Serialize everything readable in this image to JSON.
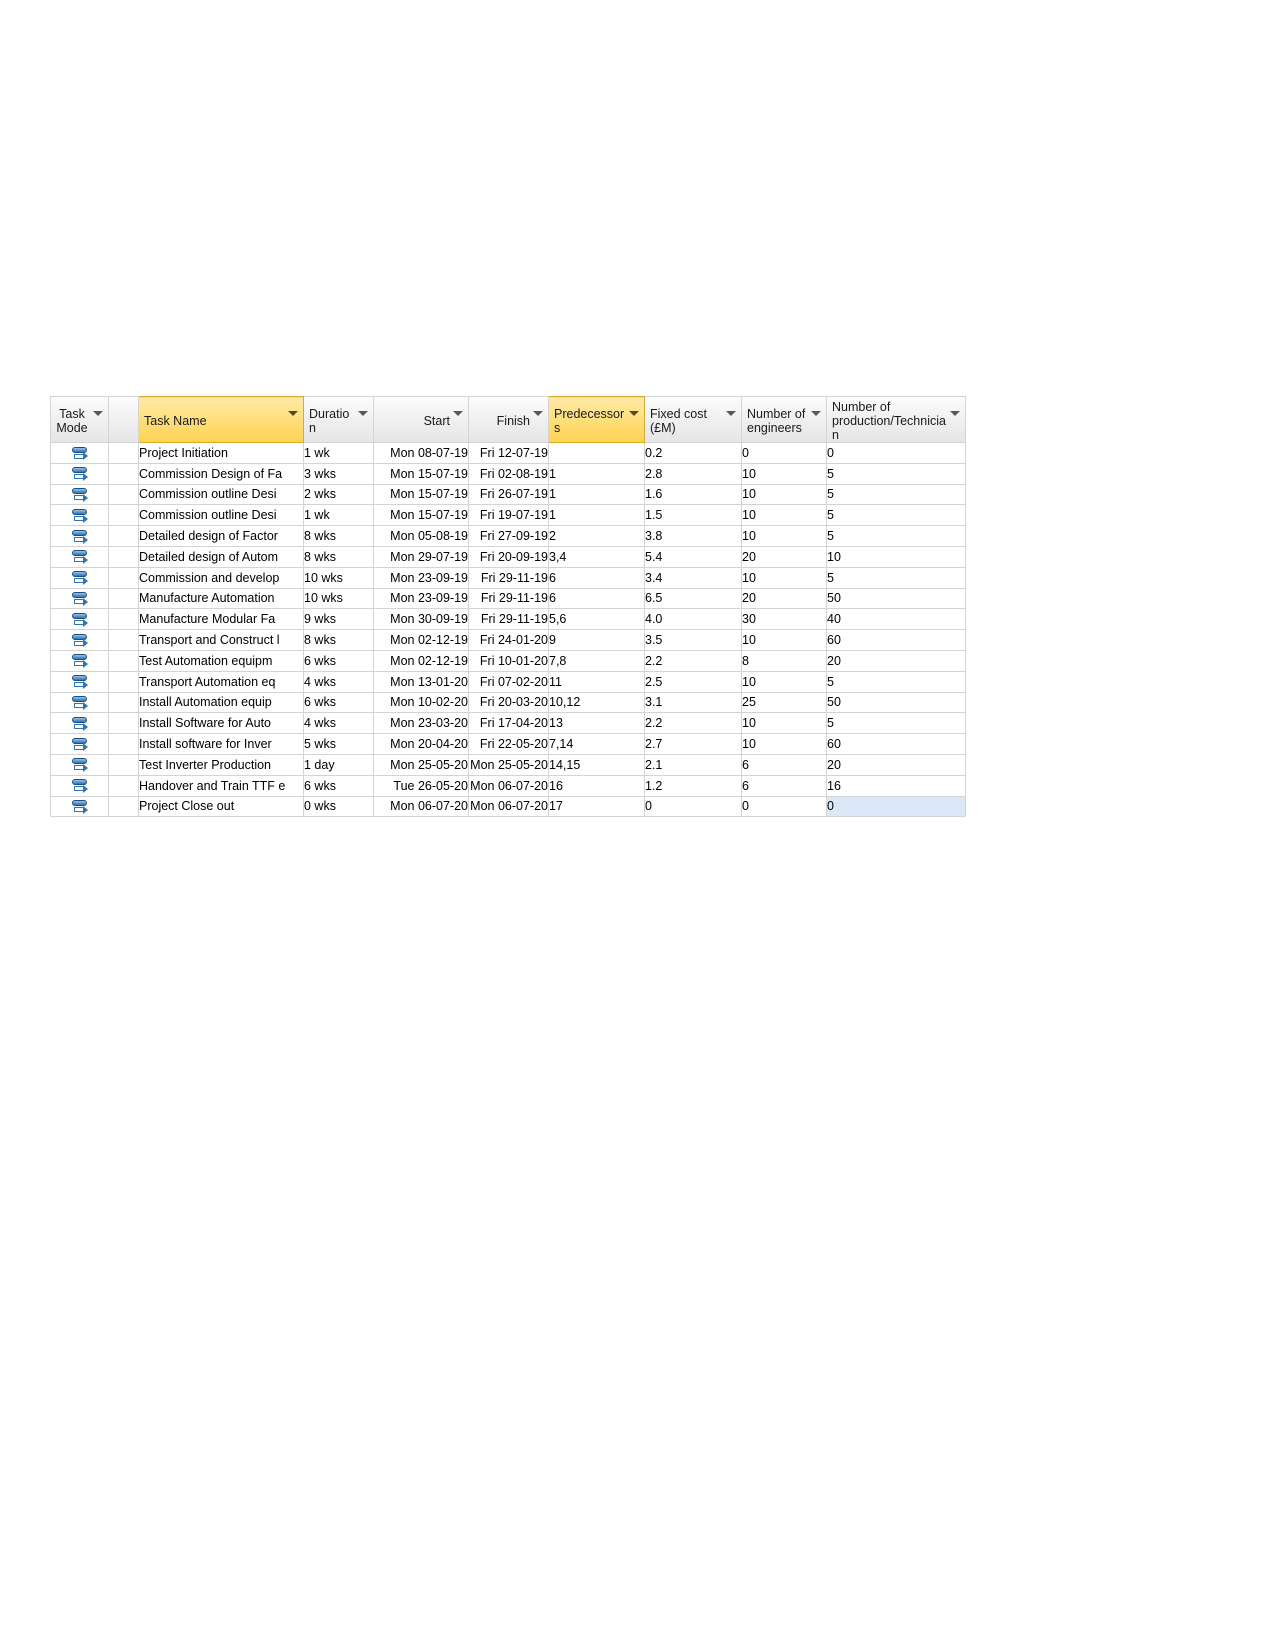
{
  "grid": {
    "columns": [
      {
        "key": "task_mode",
        "label": "Task Mode",
        "highlighted": false,
        "has_filter": true
      },
      {
        "key": "indicator",
        "label": "",
        "highlighted": false,
        "has_filter": false
      },
      {
        "key": "task_name",
        "label": "Task Name",
        "highlighted": true,
        "has_filter": true
      },
      {
        "key": "duration",
        "label": "Duration",
        "highlighted": false,
        "has_filter": true
      },
      {
        "key": "start",
        "label": "Start",
        "highlighted": false,
        "has_filter": true
      },
      {
        "key": "finish",
        "label": "Finish",
        "highlighted": false,
        "has_filter": true
      },
      {
        "key": "predecessors",
        "label": "Predecessors",
        "highlighted": true,
        "has_filter": true
      },
      {
        "key": "fixed_cost",
        "label": "Fixed cost (£M)",
        "highlighted": false,
        "has_filter": true
      },
      {
        "key": "engineers",
        "label": "Number of engineers",
        "highlighted": false,
        "has_filter": true
      },
      {
        "key": "production",
        "label": "Number of production/Technician",
        "highlighted": false,
        "has_filter": true
      }
    ],
    "rows": [
      {
        "mode_icon": "auto-schedule-icon",
        "task_name": "Project Initiation",
        "duration": "1 wk",
        "start": "Mon 08-07-19",
        "finish": "Fri 12-07-19",
        "predecessors": "",
        "fixed_cost": "0.2",
        "engineers": "0",
        "production": "0"
      },
      {
        "mode_icon": "auto-schedule-icon",
        "task_name": "Commission Design of Fa",
        "duration": "3 wks",
        "start": "Mon 15-07-19",
        "finish": "Fri 02-08-19",
        "predecessors": "1",
        "fixed_cost": "2.8",
        "engineers": "10",
        "production": "5"
      },
      {
        "mode_icon": "auto-schedule-icon",
        "task_name": "Commission outline Desi",
        "duration": "2 wks",
        "start": "Mon 15-07-19",
        "finish": "Fri 26-07-19",
        "predecessors": "1",
        "fixed_cost": "1.6",
        "engineers": "10",
        "production": "5"
      },
      {
        "mode_icon": "auto-schedule-icon",
        "task_name": "Commission outline Desi",
        "duration": "1 wk",
        "start": "Mon 15-07-19",
        "finish": "Fri 19-07-19",
        "predecessors": "1",
        "fixed_cost": "1.5",
        "engineers": "10",
        "production": "5"
      },
      {
        "mode_icon": "auto-schedule-icon",
        "task_name": "Detailed design of Factor",
        "duration": "8 wks",
        "start": "Mon 05-08-19",
        "finish": "Fri 27-09-19",
        "predecessors": "2",
        "fixed_cost": "3.8",
        "engineers": "10",
        "production": "5"
      },
      {
        "mode_icon": "auto-schedule-icon",
        "task_name": "Detailed design of Autom",
        "duration": "8 wks",
        "start": "Mon 29-07-19",
        "finish": "Fri 20-09-19",
        "predecessors": "3,4",
        "fixed_cost": "5.4",
        "engineers": "20",
        "production": "10"
      },
      {
        "mode_icon": "auto-schedule-icon",
        "task_name": "Commission and develop",
        "duration": "10 wks",
        "start": "Mon 23-09-19",
        "finish": "Fri 29-11-19",
        "predecessors": "6",
        "fixed_cost": "3.4",
        "engineers": "10",
        "production": "5"
      },
      {
        "mode_icon": "auto-schedule-icon",
        "task_name": "Manufacture Automation",
        "duration": "10 wks",
        "start": "Mon 23-09-19",
        "finish": "Fri 29-11-19",
        "predecessors": "6",
        "fixed_cost": "6.5",
        "engineers": "20",
        "production": "50"
      },
      {
        "mode_icon": "auto-schedule-icon",
        "task_name": "Manufacture Modular Fa",
        "duration": "9 wks",
        "start": "Mon 30-09-19",
        "finish": "Fri 29-11-19",
        "predecessors": "5,6",
        "fixed_cost": "4.0",
        "engineers": "30",
        "production": "40"
      },
      {
        "mode_icon": "auto-schedule-icon",
        "task_name": "Transport and Construct l",
        "duration": "8 wks",
        "start": "Mon 02-12-19",
        "finish": "Fri 24-01-20",
        "predecessors": "9",
        "fixed_cost": "3.5",
        "engineers": "10",
        "production": "60"
      },
      {
        "mode_icon": "auto-schedule-icon",
        "task_name": "Test Automation equipm",
        "duration": "6 wks",
        "start": "Mon 02-12-19",
        "finish": "Fri 10-01-20",
        "predecessors": "7,8",
        "fixed_cost": "2.2",
        "engineers": "8",
        "production": "20"
      },
      {
        "mode_icon": "auto-schedule-icon",
        "task_name": "Transport Automation eq",
        "duration": "4 wks",
        "start": "Mon 13-01-20",
        "finish": "Fri 07-02-20",
        "predecessors": "11",
        "fixed_cost": "2.5",
        "engineers": "10",
        "production": "5"
      },
      {
        "mode_icon": "auto-schedule-icon",
        "task_name": "Install Automation equip",
        "duration": "6 wks",
        "start": "Mon 10-02-20",
        "finish": "Fri 20-03-20",
        "predecessors": "10,12",
        "fixed_cost": "3.1",
        "engineers": "25",
        "production": "50"
      },
      {
        "mode_icon": "auto-schedule-icon",
        "task_name": "Install Software for Auto",
        "duration": "4 wks",
        "start": "Mon 23-03-20",
        "finish": "Fri 17-04-20",
        "predecessors": "13",
        "fixed_cost": "2.2",
        "engineers": "10",
        "production": "5"
      },
      {
        "mode_icon": "auto-schedule-icon",
        "task_name": "Install software for Inver",
        "duration": "5 wks",
        "start": "Mon 20-04-20",
        "finish": "Fri 22-05-20",
        "predecessors": "7,14",
        "fixed_cost": "2.7",
        "engineers": "10",
        "production": "60"
      },
      {
        "mode_icon": "auto-schedule-icon",
        "task_name": "Test Inverter Production",
        "duration": "1 day",
        "start": "Mon 25-05-20",
        "finish": "Mon 25-05-20",
        "predecessors": "14,15",
        "fixed_cost": "2.1",
        "engineers": "6",
        "production": "20"
      },
      {
        "mode_icon": "auto-schedule-icon",
        "task_name": "Handover and Train TTF e",
        "duration": "6 wks",
        "start": "Tue 26-05-20",
        "finish": "Mon 06-07-20",
        "predecessors": "16",
        "fixed_cost": "1.2",
        "engineers": "6",
        "production": "16"
      },
      {
        "mode_icon": "auto-schedule-icon",
        "task_name": "Project Close out",
        "duration": "0 wks",
        "start": "Mon 06-07-20",
        "finish": "Mon 06-07-20",
        "predecessors": "17",
        "fixed_cost": "0",
        "engineers": "0",
        "production": "0",
        "production_selected": true
      }
    ]
  },
  "colors": {
    "header_highlight": "#ffd24f",
    "header_default": "#f0f0f0",
    "selection": "#dce8f7",
    "task_mode_icon": "#2e75b6"
  }
}
